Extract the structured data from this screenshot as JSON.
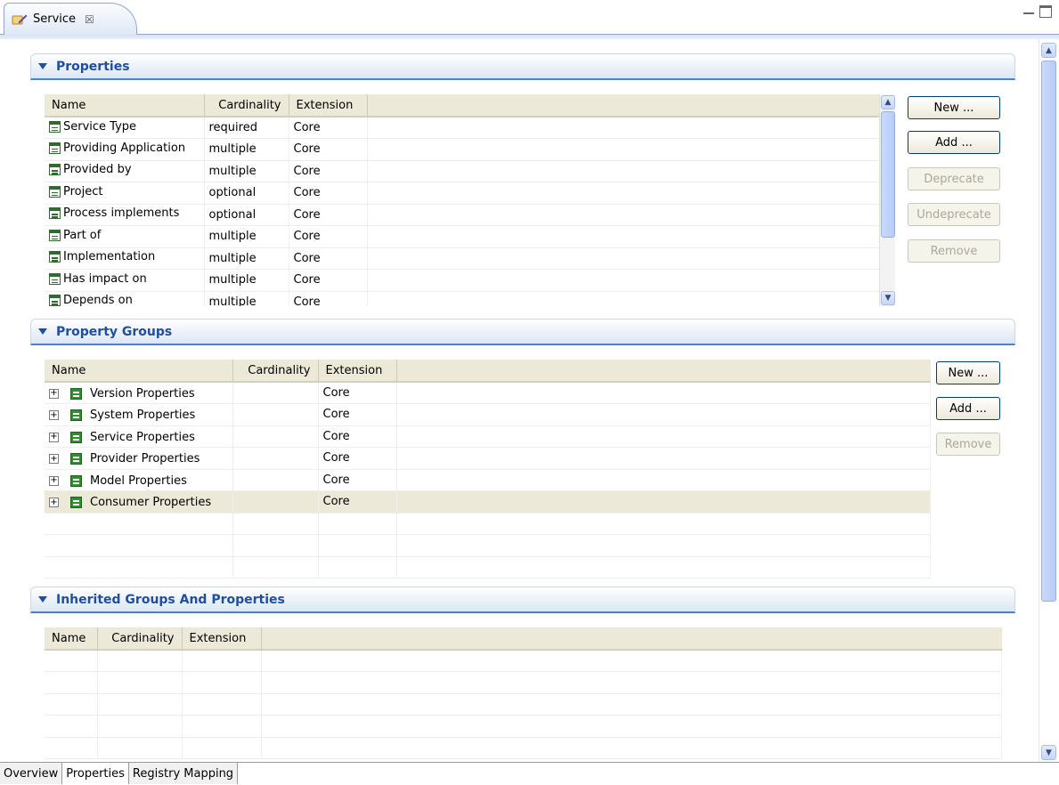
{
  "editor_tab": {
    "label": "Service",
    "close_glyph": "☒"
  },
  "sections": {
    "properties": {
      "title": "Properties",
      "columns": [
        "Name",
        "Cardinality",
        "Extension"
      ],
      "rows": [
        [
          "Service Type",
          "required",
          "Core"
        ],
        [
          "Providing Application",
          "multiple",
          "Core"
        ],
        [
          "Provided by",
          "multiple",
          "Core"
        ],
        [
          "Project",
          "optional",
          "Core"
        ],
        [
          "Process implements",
          "optional",
          "Core"
        ],
        [
          "Part of",
          "multiple",
          "Core"
        ],
        [
          "Implementation",
          "multiple",
          "Core"
        ],
        [
          "Has impact on",
          "multiple",
          "Core"
        ],
        [
          "Depends on",
          "multiple",
          "Core"
        ]
      ],
      "buttons": {
        "new": "New ...",
        "add": "Add ...",
        "deprecate": "Deprecate",
        "undeprecate": "Undeprecate",
        "remove": "Remove"
      }
    },
    "property_groups": {
      "title": "Property Groups",
      "columns": [
        "Name",
        "Cardinality",
        "Extension"
      ],
      "rows": [
        [
          "Version Properties",
          "",
          "Core"
        ],
        [
          "System Properties",
          "",
          "Core"
        ],
        [
          "Service Properties",
          "",
          "Core"
        ],
        [
          "Provider Properties",
          "",
          "Core"
        ],
        [
          "Model Properties",
          "",
          "Core"
        ],
        [
          "Consumer Properties",
          "",
          "Core"
        ]
      ],
      "buttons": {
        "new": "New ...",
        "add": "Add ...",
        "remove": "Remove"
      }
    },
    "inherited": {
      "title": "Inherited Groups And Properties",
      "columns": [
        "Name",
        "Cardinality",
        "Extension"
      ]
    }
  },
  "bottom_tabs": [
    "Overview",
    "Properties",
    "Registry Mapping"
  ],
  "colors": {
    "section_title": "#1f4fa0",
    "header_bg": "#ece9d8",
    "icon_green": "#2f8f2f"
  }
}
